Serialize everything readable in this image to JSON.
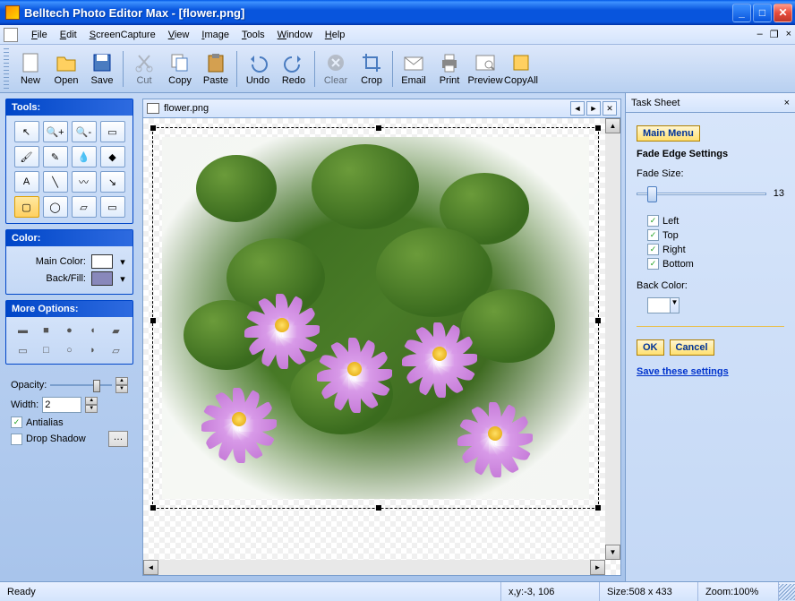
{
  "title": "Belltech Photo Editor Max - [flower.png]",
  "menu": [
    "File",
    "Edit",
    "ScreenCapture",
    "View",
    "Image",
    "Tools",
    "Window",
    "Help"
  ],
  "toolbar": [
    {
      "label": "New",
      "icon": "new"
    },
    {
      "label": "Open",
      "icon": "open"
    },
    {
      "label": "Save",
      "icon": "save"
    },
    {
      "sep": true
    },
    {
      "label": "Cut",
      "icon": "cut",
      "disabled": true
    },
    {
      "label": "Copy",
      "icon": "copy"
    },
    {
      "label": "Paste",
      "icon": "paste"
    },
    {
      "sep": true
    },
    {
      "label": "Undo",
      "icon": "undo"
    },
    {
      "label": "Redo",
      "icon": "redo"
    },
    {
      "sep": true
    },
    {
      "label": "Clear",
      "icon": "clear",
      "disabled": true
    },
    {
      "label": "Crop",
      "icon": "crop"
    },
    {
      "sep": true
    },
    {
      "label": "Email",
      "icon": "email"
    },
    {
      "label": "Print",
      "icon": "print"
    },
    {
      "label": "Preview",
      "icon": "preview"
    },
    {
      "label": "CopyAll",
      "icon": "copyall"
    }
  ],
  "sidebar": {
    "tools_header": "Tools:",
    "color_header": "Color:",
    "more_header": "More Options:",
    "main_color_label": "Main Color:",
    "back_fill_label": "Back/Fill:",
    "main_color": "#ffffff",
    "back_fill": "#8888bb",
    "opacity_label": "Opacity:",
    "width_label": "Width:",
    "width_value": "2",
    "antialias_label": "Antialias",
    "antialias": true,
    "dropshadow_label": "Drop Shadow",
    "dropshadow": false
  },
  "document": {
    "filename": "flower.png"
  },
  "tasksheet": {
    "header": "Task Sheet",
    "main_menu": "Main Menu",
    "title": "Fade Edge Settings",
    "fade_size_label": "Fade Size:",
    "fade_size_value": "13",
    "left_label": "Left",
    "left": true,
    "top_label": "Top",
    "top": true,
    "right_label": "Right",
    "right": true,
    "bottom_label": "Bottom",
    "bottom": true,
    "back_color_label": "Back Color:",
    "back_color": "#ffffff",
    "ok": "OK",
    "cancel": "Cancel",
    "save_link": "Save these settings"
  },
  "status": {
    "ready": "Ready",
    "xy": "x,y:-3, 106",
    "size": "Size:508 x 433",
    "zoom": "Zoom:100%"
  }
}
